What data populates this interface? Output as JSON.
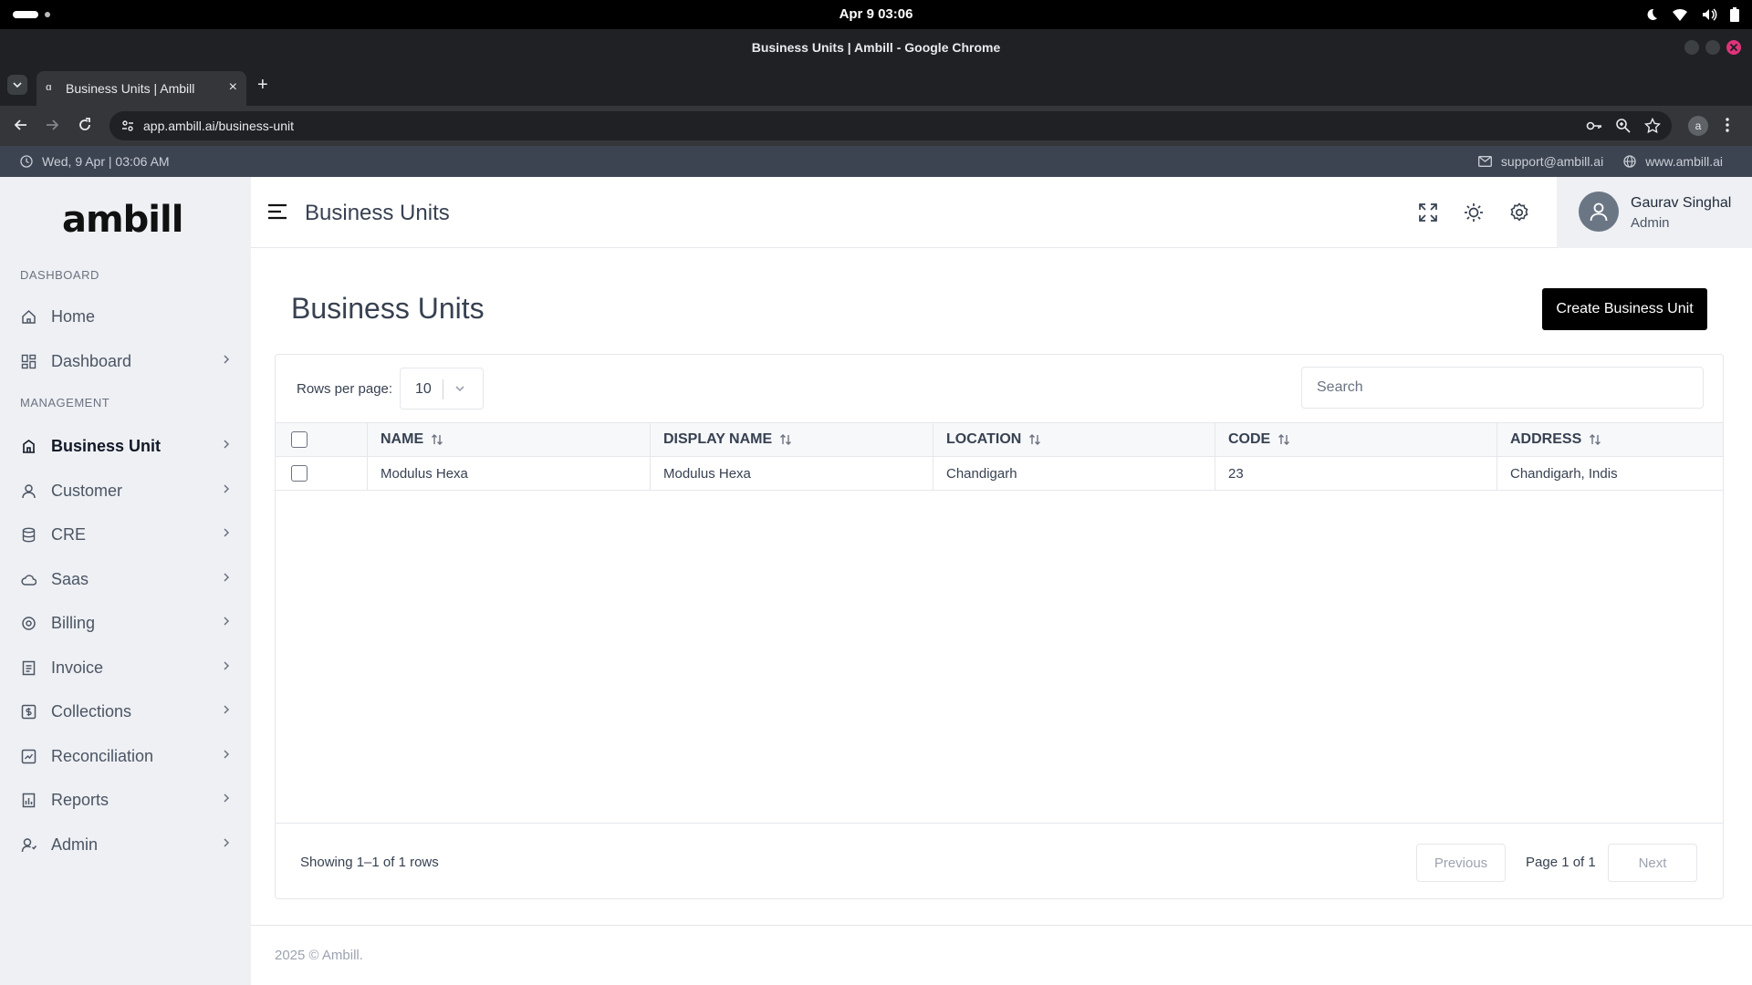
{
  "os": {
    "clock": "Apr 9  03:06"
  },
  "browser": {
    "window_title": "Business Units | Ambill - Google Chrome",
    "tab_title": "Business Units | Ambill",
    "tab_close": "×",
    "new_tab": "+",
    "url": "app.ambill.ai/business-unit",
    "profile_initial": "a"
  },
  "info_bar": {
    "datetime": "Wed, 9 Apr | 03:06 AM",
    "support_email": "support@ambill.ai",
    "website": "www.ambill.ai"
  },
  "sidebar": {
    "logo": "ambill",
    "sections": [
      {
        "label": "DASHBOARD"
      },
      {
        "label": "MANAGEMENT"
      }
    ],
    "items": [
      {
        "label": "Home",
        "icon": "home-icon"
      },
      {
        "label": "Dashboard",
        "icon": "dashboard-icon"
      },
      {
        "label": "Business Unit",
        "icon": "building-icon",
        "active": true
      },
      {
        "label": "Customer",
        "icon": "user-icon"
      },
      {
        "label": "CRE",
        "icon": "database-icon"
      },
      {
        "label": "Saas",
        "icon": "cloud-icon"
      },
      {
        "label": "Billing",
        "icon": "billing-icon"
      },
      {
        "label": "Invoice",
        "icon": "invoice-icon"
      },
      {
        "label": "Collections",
        "icon": "collections-icon"
      },
      {
        "label": "Reconciliation",
        "icon": "reconciliation-icon"
      },
      {
        "label": "Reports",
        "icon": "reports-icon"
      },
      {
        "label": "Admin",
        "icon": "admin-icon"
      }
    ]
  },
  "header": {
    "title": "Business Units",
    "user": {
      "name": "Gaurav Singhal",
      "role": "Admin"
    }
  },
  "main": {
    "heading": "Business Units",
    "create_button": "Create Business Unit",
    "rows_per_page_label": "Rows per page:",
    "rows_per_page_value": "10",
    "search_placeholder": "Search",
    "table": {
      "columns": [
        "NAME",
        "DISPLAY NAME",
        "LOCATION",
        "CODE",
        "ADDRESS"
      ],
      "rows": [
        [
          "Modulus Hexa",
          "Modulus Hexa",
          "Chandigarh",
          "23",
          "Chandigarh, Indis"
        ]
      ]
    },
    "showing": "Showing 1–1 of 1 rows",
    "pagination": {
      "previous": "Previous",
      "page_info": "Page 1 of 1",
      "next": "Next"
    }
  },
  "footer": {
    "text": "2025 © Ambill."
  },
  "colors": {
    "accent": "#000000",
    "sidebar_bg": "#eef0f4",
    "info_bar_bg": "#3d4451"
  }
}
